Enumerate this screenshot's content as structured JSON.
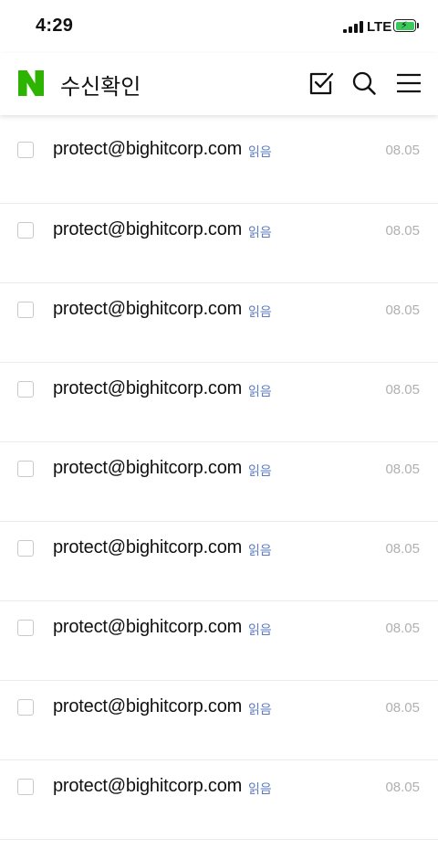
{
  "status_bar": {
    "time": "4:29",
    "network": "LTE",
    "battery_level": 0.8,
    "battery_color": "#3ac95a"
  },
  "header": {
    "logo_letter": "N",
    "logo_color": "#2db400",
    "title": "수신확인",
    "icons": [
      "check-square-icon",
      "search-icon",
      "menu-icon"
    ]
  },
  "mails": [
    {
      "sender": "protect@bighitcorp.com",
      "status": "읽음",
      "date": "08.05"
    },
    {
      "sender": "protect@bighitcorp.com",
      "status": "읽음",
      "date": "08.05"
    },
    {
      "sender": "protect@bighitcorp.com",
      "status": "읽음",
      "date": "08.05"
    },
    {
      "sender": "protect@bighitcorp.com",
      "status": "읽음",
      "date": "08.05"
    },
    {
      "sender": "protect@bighitcorp.com",
      "status": "읽음",
      "date": "08.05"
    },
    {
      "sender": "protect@bighitcorp.com",
      "status": "읽음",
      "date": "08.05"
    },
    {
      "sender": "protect@bighitcorp.com",
      "status": "읽음",
      "date": "08.05"
    },
    {
      "sender": "protect@bighitcorp.com",
      "status": "읽음",
      "date": "08.05"
    },
    {
      "sender": "protect@bighitcorp.com",
      "status": "읽음",
      "date": "08.05"
    }
  ]
}
